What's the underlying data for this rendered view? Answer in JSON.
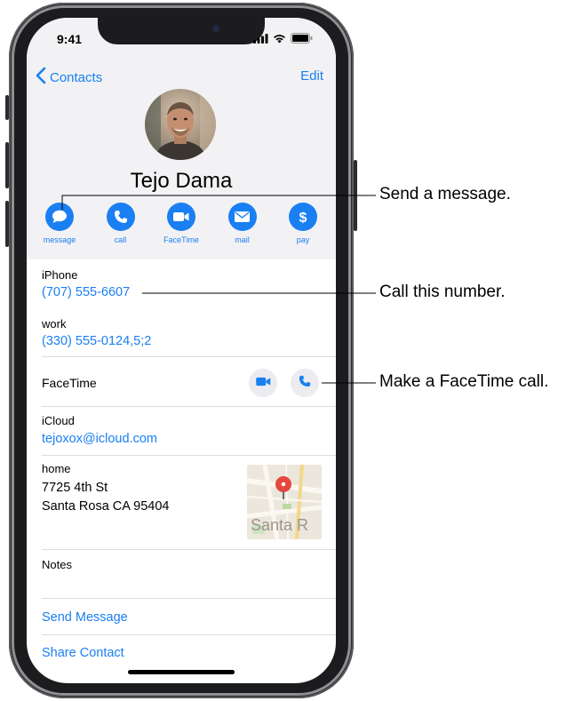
{
  "status_bar": {
    "time": "9:41"
  },
  "nav": {
    "back_label": "Contacts",
    "edit_label": "Edit"
  },
  "contact": {
    "name": "Tejo Dama",
    "actions": [
      {
        "label": "message",
        "icon": "message-bubble-icon"
      },
      {
        "label": "call",
        "icon": "phone-icon"
      },
      {
        "label": "FaceTime",
        "icon": "video-camera-icon"
      },
      {
        "label": "mail",
        "icon": "envelope-icon"
      },
      {
        "label": "pay",
        "icon": "dollar-icon"
      }
    ]
  },
  "details": {
    "iphone_label": "iPhone",
    "iphone_value": "(707) 555-6607",
    "work_label": "work",
    "work_value": "(330) 555-0124,5;2",
    "facetime_label": "FaceTime",
    "icloud_label": "iCloud",
    "icloud_value": "tejoxox@icloud.com",
    "home_label": "home",
    "home_line1": "7725 4th St",
    "home_line2": "Santa Rosa CA 95404",
    "map_text": "Santa R",
    "notes_label": "Notes"
  },
  "links": {
    "send_message": "Send Message",
    "share_contact": "Share Contact"
  },
  "callouts": {
    "message": "Send a message.",
    "call": "Call this number.",
    "facetime": "Make a FaceTime call."
  },
  "colors": {
    "accent": "#1a7ff2",
    "header_bg": "#f2f2f4",
    "map_pin": "#e8473e"
  }
}
